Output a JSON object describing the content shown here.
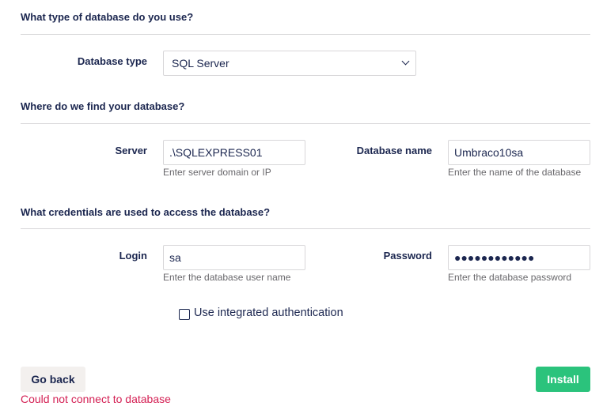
{
  "db_section": {
    "title": "What type of database do you use?",
    "type_label": "Database type",
    "type_selected": "SQL Server"
  },
  "location_section": {
    "title": "Where do we find your database?",
    "server_label": "Server",
    "server_value": ".\\SQLEXPRESS01",
    "server_hint": "Enter server domain or IP",
    "dbname_label": "Database name",
    "dbname_value": "Umbraco10sa",
    "dbname_hint": "Enter the name of the database"
  },
  "credentials_section": {
    "title": "What credentials are used to access the database?",
    "login_label": "Login",
    "login_value": "sa",
    "login_hint": "Enter the database user name",
    "password_label": "Password",
    "password_mask": "●●●●●●●●●●●●",
    "password_hint": "Enter the database password",
    "integrated_auth_label": "Use integrated authentication"
  },
  "actions": {
    "back_label": "Go back",
    "install_label": "Install"
  },
  "error_message": "Could not connect to database",
  "colors": {
    "text": "#1b264f",
    "install": "#2bc37c",
    "back": "#f3f0ee",
    "error": "#d42054",
    "border": "#d8d7d9"
  }
}
